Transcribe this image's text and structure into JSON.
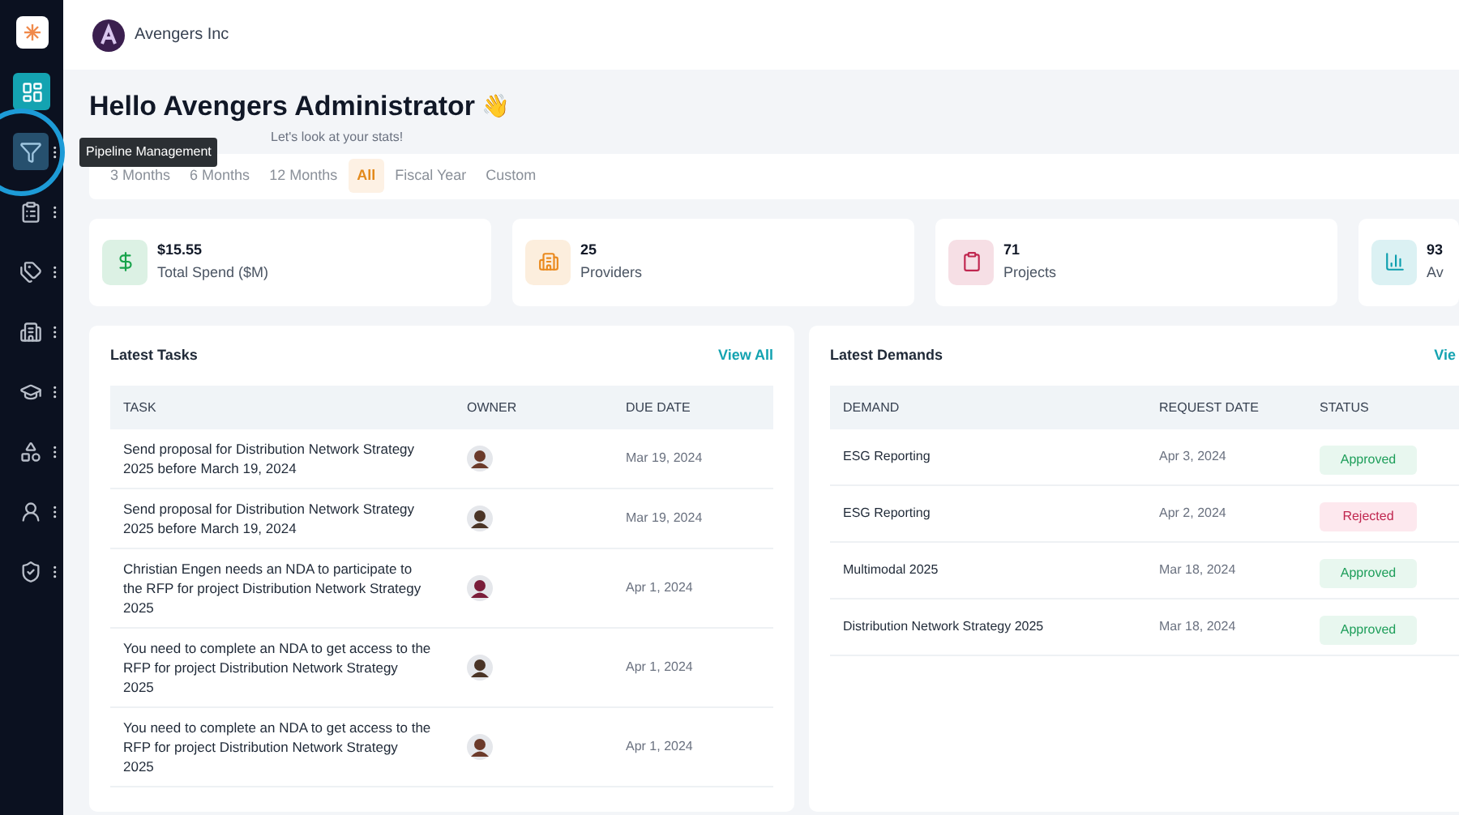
{
  "sidebar": {
    "items": [
      {
        "selected": true,
        "highlighted": false
      },
      {
        "selected": false,
        "highlighted": true
      },
      {
        "selected": false,
        "highlighted": false
      },
      {
        "selected": false,
        "highlighted": false
      },
      {
        "selected": false,
        "highlighted": false
      },
      {
        "selected": false,
        "highlighted": false
      },
      {
        "selected": false,
        "highlighted": false
      },
      {
        "selected": false,
        "highlighted": false
      },
      {
        "selected": false,
        "highlighted": false
      }
    ],
    "tooltip": "Pipeline Management"
  },
  "header": {
    "company": "Avengers Inc"
  },
  "greeting": {
    "title": "Hello Avengers Administrator",
    "emoji": "👋",
    "subtitle": "Let's look at your stats!"
  },
  "periods": [
    {
      "label": "3 Months",
      "selected": false
    },
    {
      "label": "6 Months",
      "selected": false
    },
    {
      "label": "12 Months",
      "selected": false
    },
    {
      "label": "All",
      "selected": true
    },
    {
      "label": "Fiscal Year",
      "selected": false
    },
    {
      "label": "Custom",
      "selected": false
    }
  ],
  "stats": [
    {
      "color": "#16a34a",
      "value": "$15.55",
      "label": "Total Spend ($M)"
    },
    {
      "color": "#ea8a1e",
      "value": "25",
      "label": "Providers"
    },
    {
      "color": "#c0264f",
      "value": "71",
      "label": "Projects"
    },
    {
      "color": "#0e9fae",
      "value": "93",
      "label": "Av"
    }
  ],
  "tasks": {
    "title": "Latest Tasks",
    "link": "View All",
    "columns": [
      "TASK",
      "OWNER",
      "DUE DATE"
    ],
    "rows": [
      {
        "task": "Send proposal for Distribution Network Strategy 2025 before March 19, 2024",
        "owner": {
          "color": "#6b3a2a"
        },
        "due": "Mar 19, 2024"
      },
      {
        "task": "Send proposal for Distribution Network Strategy 2025 before March 19, 2024",
        "owner": {
          "color": "#4a3426"
        },
        "due": "Mar 19, 2024"
      },
      {
        "task": "Christian Engen needs an NDA to participate to the RFP for project Distribution Network Strategy 2025",
        "owner": {
          "color": "#7a1e3a"
        },
        "due": "Apr 1, 2024"
      },
      {
        "task": "You need to complete an NDA to get access to the RFP for project Distribution Network Strategy 2025",
        "owner": {
          "color": "#4a3426"
        },
        "due": "Apr 1, 2024"
      },
      {
        "task": "You need to complete an NDA to get access to the RFP for project Distribution Network Strategy 2025",
        "owner": {
          "color": "#6b3a2a"
        },
        "due": "Apr 1, 2024"
      }
    ]
  },
  "demands": {
    "title": "Latest Demands",
    "link": "Vie",
    "columns": [
      "DEMAND",
      "REQUEST DATE",
      "STATUS"
    ],
    "rows": [
      {
        "demand": "ESG Reporting",
        "date": "Apr 3, 2024",
        "status": "Approved",
        "kind": "approved"
      },
      {
        "demand": "ESG Reporting",
        "date": "Apr 2, 2024",
        "status": "Rejected",
        "kind": "rejected"
      },
      {
        "demand": "Multimodal 2025",
        "date": "Mar 18, 2024",
        "status": "Approved",
        "kind": "approved"
      },
      {
        "demand": "Distribution Network Strategy 2025",
        "date": "Mar 18, 2024",
        "status": "Approved",
        "kind": "approved"
      }
    ]
  }
}
